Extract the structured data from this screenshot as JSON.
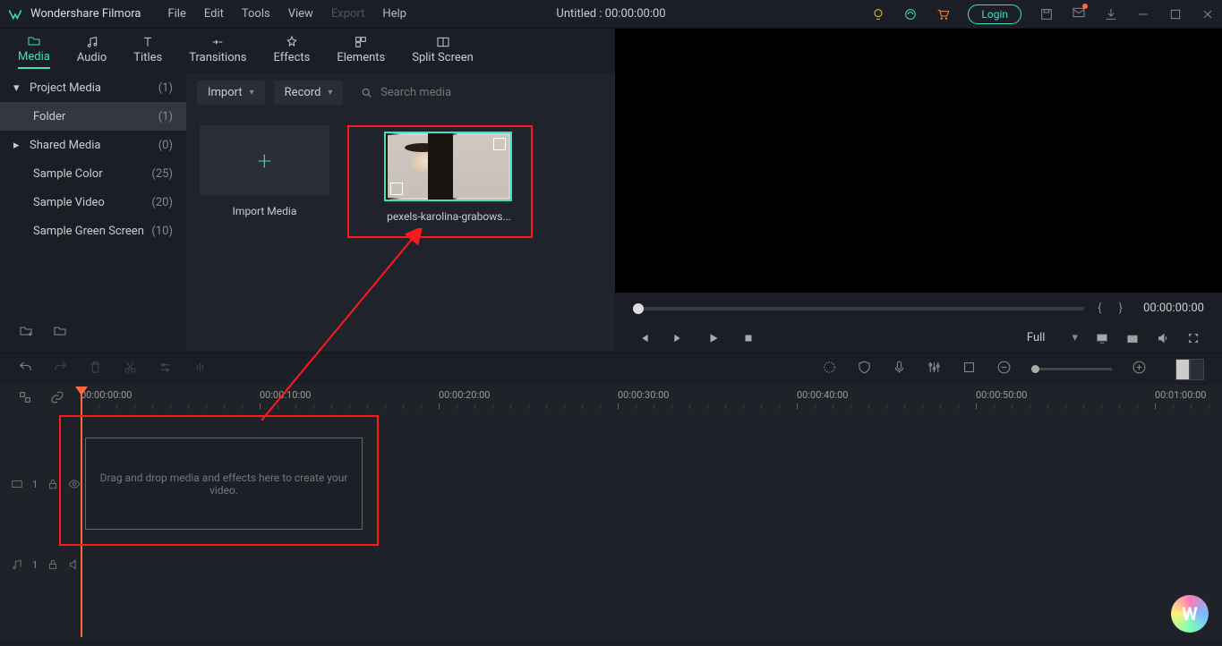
{
  "app": {
    "name": "Wondershare Filmora",
    "doc": "Untitled : 00:00:00:00"
  },
  "menu": [
    "File",
    "Edit",
    "Tools",
    "View",
    "Export",
    "Help"
  ],
  "login": "Login",
  "tabs": [
    {
      "label": "Media",
      "active": true
    },
    {
      "label": "Audio"
    },
    {
      "label": "Titles"
    },
    {
      "label": "Transitions"
    },
    {
      "label": "Effects"
    },
    {
      "label": "Elements"
    },
    {
      "label": "Split Screen"
    }
  ],
  "export_btn": "Export",
  "sidebar": {
    "items": [
      {
        "label": "Project Media",
        "count": "(1)",
        "arrow": "▾"
      },
      {
        "label": "Folder",
        "count": "(1)",
        "sel": true,
        "indent": true
      },
      {
        "label": "Shared Media",
        "count": "(0)",
        "arrow": "▸"
      },
      {
        "label": "Sample Color",
        "count": "(25)"
      },
      {
        "label": "Sample Video",
        "count": "(20)"
      },
      {
        "label": "Sample Green Screen",
        "count": "(10)"
      }
    ]
  },
  "media": {
    "import": "Import",
    "record": "Record",
    "search_ph": "Search media",
    "import_media": "Import Media",
    "clip": "pexels-karolina-grabows..."
  },
  "preview": {
    "time": "00:00:00:00",
    "full": "Full"
  },
  "timeline": {
    "marks": [
      "00:00:00:00",
      "00:00:10:00",
      "00:00:20:00",
      "00:00:30:00",
      "00:00:40:00",
      "00:00:50:00",
      "00:01:00:00"
    ],
    "drop": "Drag and drop media and effects here to create your video.",
    "vtrack": "1",
    "atrack": "1"
  }
}
